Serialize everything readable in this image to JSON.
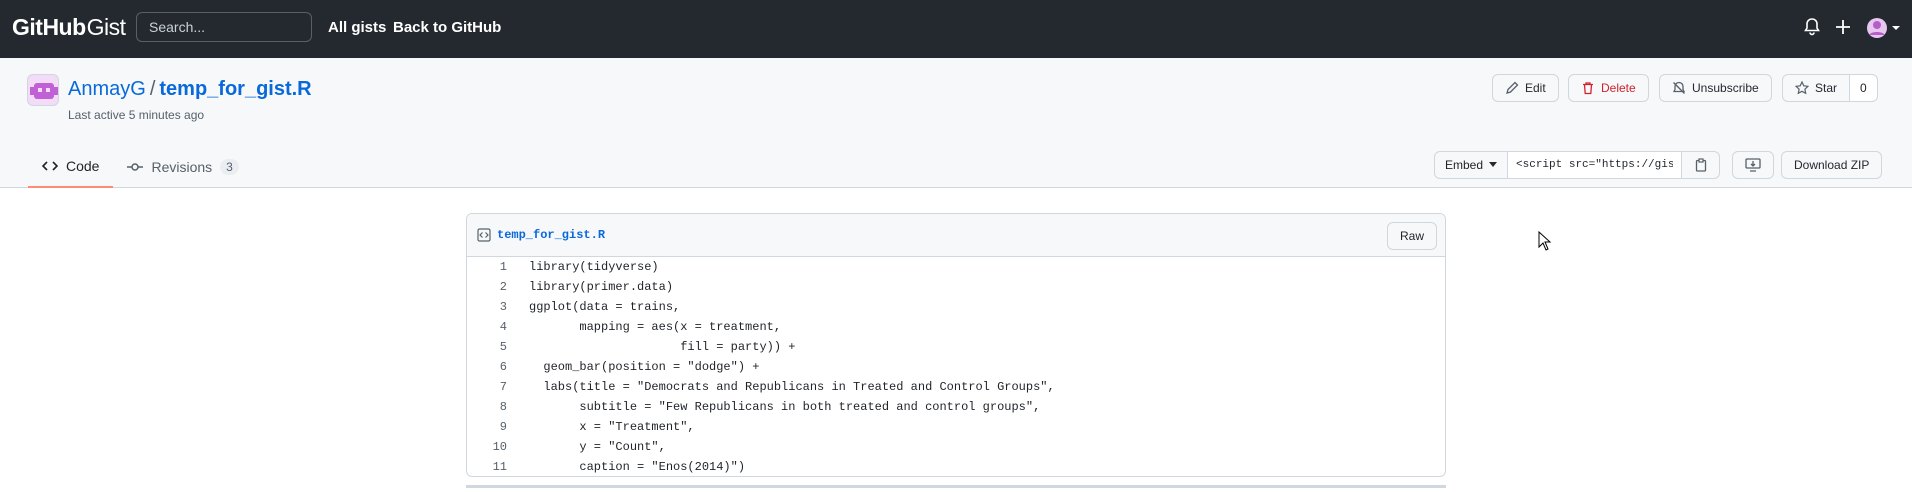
{
  "header": {
    "logo_main": "GitHub",
    "logo_sub": "Gist",
    "search_placeholder": "Search...",
    "nav": [
      "All gists",
      "Back to GitHub"
    ],
    "icons": [
      "bell-icon",
      "plus-icon",
      "avatar-menu"
    ]
  },
  "gist": {
    "owner": "AnmayG",
    "separator": "/",
    "filename": "temp_for_gist.R",
    "last_active": "Last active 5 minutes ago",
    "actions": {
      "edit": "Edit",
      "delete": "Delete",
      "unsubscribe": "Unsubscribe",
      "star": "Star",
      "star_count": "0"
    },
    "tabs": [
      {
        "label": "Code",
        "active": true
      },
      {
        "label": "Revisions",
        "count": "3",
        "active": false
      }
    ],
    "embed": {
      "label": "Embed",
      "value": "<script src=\"https://gist.github.com/AnmayG/"
    },
    "download": "Download ZIP"
  },
  "file": {
    "name": "temp_for_gist.R",
    "raw_label": "Raw",
    "lines": [
      {
        "n": "1",
        "text": "library(tidyverse)"
      },
      {
        "n": "2",
        "text": "library(primer.data)"
      },
      {
        "n": "3",
        "text": "ggplot(data = trains,"
      },
      {
        "n": "4",
        "text": "       mapping = aes(x = treatment,"
      },
      {
        "n": "5",
        "text": "                     fill = party)) +"
      },
      {
        "n": "6",
        "text": "  geom_bar(position = \"dodge\") +"
      },
      {
        "n": "7",
        "text": "  labs(title = \"Democrats and Republicans in Treated and Control Groups\","
      },
      {
        "n": "8",
        "text": "       subtitle = \"Few Republicans in both treated and control groups\","
      },
      {
        "n": "9",
        "text": "       x = \"Treatment\","
      },
      {
        "n": "10",
        "text": "       y = \"Count\","
      },
      {
        "n": "11",
        "text": "       caption = \"Enos(2014)\")"
      }
    ]
  },
  "colors": {
    "header_bg": "#24292f",
    "link": "#0969da",
    "danger": "#cf222e",
    "tab_underline": "#fd8c73"
  }
}
